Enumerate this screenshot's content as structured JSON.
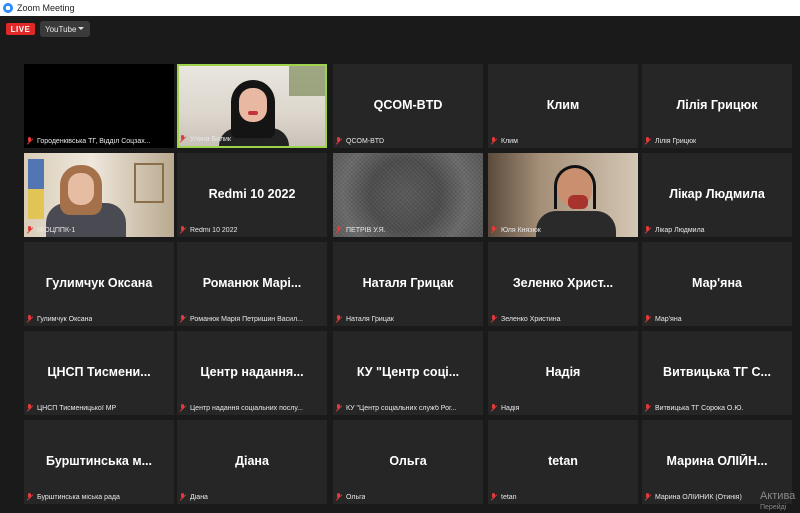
{
  "window": {
    "title": "Zoom Meeting"
  },
  "topbar": {
    "live_badge": "LIVE",
    "stream_target": "YouTube"
  },
  "participants": [
    {
      "big": "",
      "name": "Городенківська ТГ, Відділ Соцзах...",
      "video": "dark"
    },
    {
      "big": "",
      "name": "Уляна Бялик",
      "video": "woman",
      "active": true
    },
    {
      "big": "QCOM-BTD",
      "name": "QCOM-BTD"
    },
    {
      "big": "Клим",
      "name": "Клим"
    },
    {
      "big": "Лілія Грицюк",
      "name": "Лілія Грицюк"
    },
    {
      "big": "",
      "name": "ІФОЦППК-1",
      "video": "office"
    },
    {
      "big": "Redmi 10 2022",
      "name": "Redmi 10 2022"
    },
    {
      "big": "",
      "name": "ПЕТРІВ У.Я.",
      "video": "noise"
    },
    {
      "big": "",
      "name": "Юля Князюк",
      "video": "headset"
    },
    {
      "big": "Лікар Людмила",
      "name": "Лікар Людмила"
    },
    {
      "big": "Гулимчук Оксана",
      "name": "Гулимчук Оксана"
    },
    {
      "big": "Романюк Марі...",
      "name": "Романюк Марія Петришин Васил..."
    },
    {
      "big": "Наталя Грицак",
      "name": "Наталя Грицак"
    },
    {
      "big": "Зеленко Христ...",
      "name": "Зеленко Христина"
    },
    {
      "big": "Мар'яна",
      "name": "Мар'яна"
    },
    {
      "big": "ЦНСП Тисмени...",
      "name": "ЦНСП Тисменицької МР"
    },
    {
      "big": "Центр надання...",
      "name": "Центр надання соціальних послу..."
    },
    {
      "big": "КУ \"Центр соці...",
      "name": "КУ \"Центр соціальних служб Рог..."
    },
    {
      "big": "Надія",
      "name": "Надія"
    },
    {
      "big": "Витвицька ТГ С...",
      "name": "Витвицька ТГ Сорока О.Ю."
    },
    {
      "big": "Бурштинська м...",
      "name": "Бурштинська міська рада"
    },
    {
      "big": "Діана",
      "name": "Діана"
    },
    {
      "big": "Ольга",
      "name": "Ольга"
    },
    {
      "big": "tetan",
      "name": "tetan"
    },
    {
      "big": "Марина ОЛІЙН...",
      "name": "Марина ОЛІЙНИК (Отинія)"
    }
  ],
  "watermark": {
    "line1": "Актива",
    "line2": "Перейді"
  },
  "colors": {
    "live": "#e02828",
    "active_border": "#9dd34b",
    "muted_mic": "#e23a3a"
  }
}
